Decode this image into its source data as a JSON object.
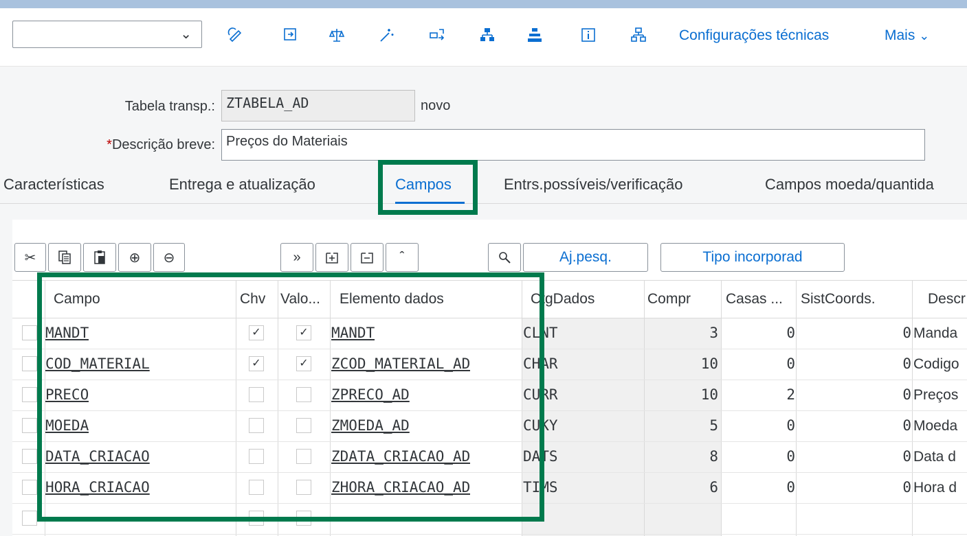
{
  "toolbar": {
    "command_value": "",
    "technical_settings": "Configurações técnicas",
    "more": "Mais",
    "icons": [
      "display-change-icon",
      "activate-icon",
      "compare-icon",
      "wizard-icon",
      "where-used-icon",
      "hierarchy-icon",
      "append-structure-icon",
      "info-icon",
      "object-list-icon"
    ]
  },
  "form": {
    "table_label": "Tabela transp.:",
    "table_value": "ZTABELA_AD",
    "status": "novo",
    "desc_required_mark": "*",
    "desc_label": "Descrição breve:",
    "desc_value": "Preços do Materiais"
  },
  "tabs": [
    "Características",
    "Entrega e atualização",
    "Campos",
    "Entrs.possíveis/verificação",
    "Campos moeda/quantida"
  ],
  "active_tab": "Campos",
  "table_toolbar": {
    "search_help": "Aj.pesq.",
    "include_type": "Tipo incorporad"
  },
  "grid": {
    "headers": [
      "Campo",
      "Chv",
      "Valo...",
      "Elemento dados",
      "CtgDados",
      "Compr",
      "Casas ...",
      "SistCoords.",
      "Descr"
    ],
    "rows": [
      {
        "campo": "MANDT",
        "chv": true,
        "valor": true,
        "elemento": "MANDT",
        "tipo": "CLNT",
        "compr": "3",
        "casas": "0",
        "coord": "0",
        "descr": "Manda"
      },
      {
        "campo": "COD_MATERIAL",
        "chv": true,
        "valor": true,
        "elemento": "ZCOD_MATERIAL_AD",
        "tipo": "CHAR",
        "compr": "10",
        "casas": "0",
        "coord": "0",
        "descr": "Codigo"
      },
      {
        "campo": "PRECO",
        "chv": false,
        "valor": false,
        "elemento": "ZPRECO_AD",
        "tipo": "CURR",
        "compr": "10",
        "casas": "2",
        "coord": "0",
        "descr": "Preços"
      },
      {
        "campo": "MOEDA",
        "chv": false,
        "valor": false,
        "elemento": "ZMOEDA_AD",
        "tipo": "CUKY",
        "compr": "5",
        "casas": "0",
        "coord": "0",
        "descr": "Moeda"
      },
      {
        "campo": "DATA_CRIACAO",
        "chv": false,
        "valor": false,
        "elemento": "ZDATA_CRIACAO_AD",
        "tipo": "DATS",
        "compr": "8",
        "casas": "0",
        "coord": "0",
        "descr": "Data d"
      },
      {
        "campo": "HORA_CRIACAO",
        "chv": false,
        "valor": false,
        "elemento": "ZHORA_CRIACAO_AD",
        "tipo": "TIMS",
        "compr": "6",
        "casas": "0",
        "coord": "0",
        "descr": "Hora d"
      }
    ]
  },
  "colors": {
    "accent": "#0a6ed1",
    "highlight": "#007a4d",
    "topbar": "#a9c2de"
  }
}
